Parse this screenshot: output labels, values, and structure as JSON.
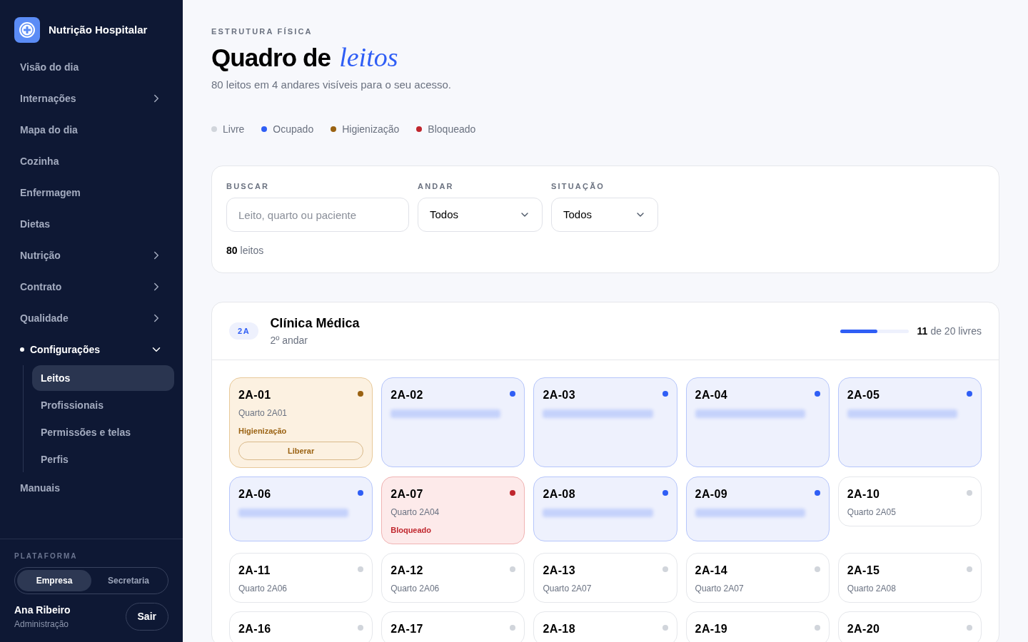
{
  "brand": {
    "name": "Nutrição Hospitalar"
  },
  "nav": [
    {
      "label": "Visão do dia",
      "selected": false
    },
    {
      "label": "Internações",
      "expanded": false,
      "selected": false
    },
    {
      "label": "Mapa do dia",
      "selected": false
    },
    {
      "label": "Cozinha",
      "selected": false
    },
    {
      "label": "Enfermagem",
      "selected": false
    },
    {
      "label": "Dietas",
      "selected": false
    },
    {
      "label": "Nutrição",
      "expanded": false,
      "selected": false
    },
    {
      "label": "Contrato",
      "expanded": false,
      "selected": false
    },
    {
      "label": "Qualidade",
      "expanded": false,
      "selected": false
    },
    {
      "label": "Configurações",
      "expanded": true,
      "selected": true,
      "children": [
        {
          "label": "Leitos",
          "selected": true
        },
        {
          "label": "Profissionais",
          "selected": false
        },
        {
          "label": "Permissões e telas",
          "selected": false
        },
        {
          "label": "Perfis",
          "selected": false
        }
      ]
    },
    {
      "label": "Manuais",
      "selected": false
    }
  ],
  "platform": {
    "label": "PLATAFORMA",
    "options": [
      {
        "label": "Empresa",
        "selected": true
      },
      {
        "label": "Secretaria",
        "selected": false
      }
    ]
  },
  "user": {
    "name": "Ana Ribeiro",
    "role": "Administração",
    "logout": "Sair"
  },
  "header": {
    "eyebrow": "ESTRUTURA FÍSICA",
    "title": "Quadro de",
    "title_accent": "leitos",
    "subtitle": "80 leitos em 4 andares visíveis para o seu acesso."
  },
  "legend": [
    {
      "label": "Livre",
      "color": "#d1d5db"
    },
    {
      "label": "Ocupado",
      "color": "#2f5ef5"
    },
    {
      "label": "Higienização",
      "color": "#9a6212"
    },
    {
      "label": "Bloqueado",
      "color": "#c0262d"
    }
  ],
  "filters": {
    "search": {
      "label": "BUSCAR",
      "placeholder": "Leito, quarto ou paciente"
    },
    "floor": {
      "label": "ANDAR",
      "value": "Todos"
    },
    "status": {
      "label": "SITUAÇÃO",
      "value": "Todos"
    },
    "count": "80",
    "count_label": "leitos"
  },
  "floor": {
    "badge": "2A",
    "name": "Clínica Médica",
    "subtitle": "2º andar",
    "level": 0.55,
    "free": "11",
    "free_label": "de 20 livres",
    "beds": [
      {
        "code": "2A-01",
        "kind": "cleaning",
        "room": "Quarto 2A01",
        "status_label": "Higienização",
        "action": "Liberar"
      },
      {
        "code": "2A-02",
        "kind": "occupied"
      },
      {
        "code": "2A-03",
        "kind": "occupied"
      },
      {
        "code": "2A-04",
        "kind": "occupied"
      },
      {
        "code": "2A-05",
        "kind": "occupied"
      },
      {
        "code": "2A-06",
        "kind": "occupied"
      },
      {
        "code": "2A-07",
        "kind": "blocked",
        "room": "Quarto 2A04",
        "status_label": "Bloqueado"
      },
      {
        "code": "2A-08",
        "kind": "occupied"
      },
      {
        "code": "2A-09",
        "kind": "occupied"
      },
      {
        "code": "2A-10",
        "kind": "free",
        "room": "Quarto 2A05"
      },
      {
        "code": "2A-11",
        "kind": "free",
        "room": "Quarto 2A06"
      },
      {
        "code": "2A-12",
        "kind": "free",
        "room": "Quarto 2A06"
      },
      {
        "code": "2A-13",
        "kind": "free",
        "room": "Quarto 2A07"
      },
      {
        "code": "2A-14",
        "kind": "free",
        "room": "Quarto 2A07"
      },
      {
        "code": "2A-15",
        "kind": "free",
        "room": "Quarto 2A08"
      },
      {
        "code": "2A-16",
        "kind": "free"
      },
      {
        "code": "2A-17",
        "kind": "free"
      },
      {
        "code": "2A-18",
        "kind": "free"
      },
      {
        "code": "2A-19",
        "kind": "free"
      },
      {
        "code": "2A-20",
        "kind": "free"
      }
    ]
  }
}
